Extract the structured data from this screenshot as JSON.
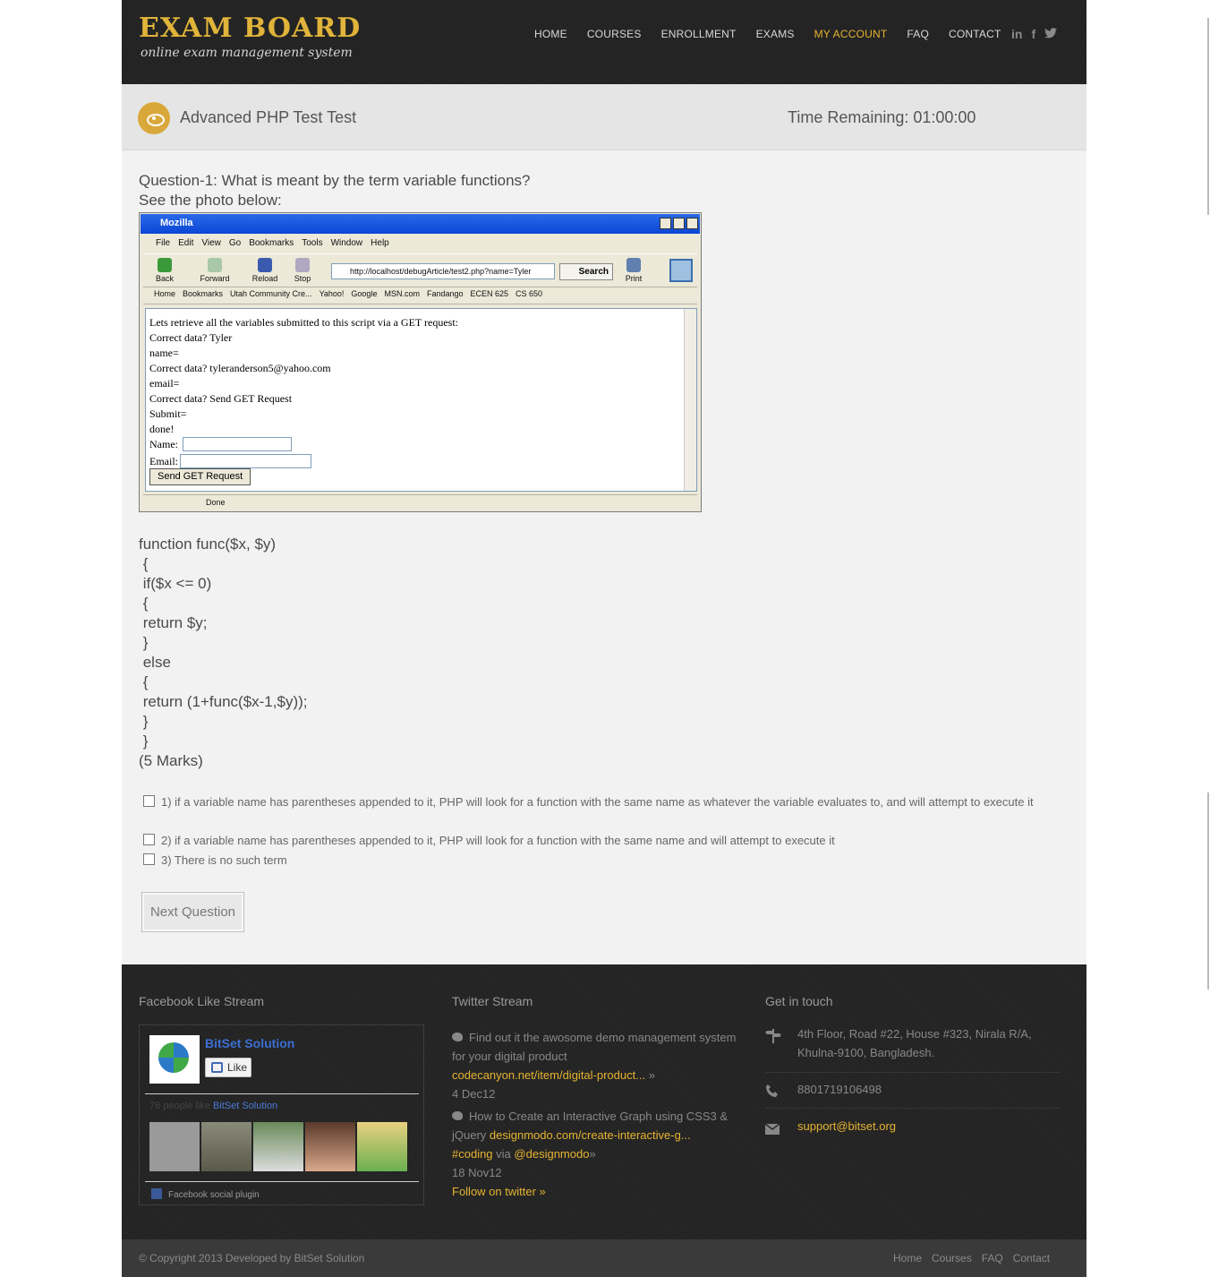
{
  "header": {
    "logo_title": "EXAM BOARD",
    "logo_subtitle": "online exam management system",
    "nav": [
      "HOME",
      "COURSES",
      "ENROLLMENT",
      "EXAMS",
      "MY ACCOUNT",
      "FAQ",
      "CONTACT"
    ],
    "active_nav": "MY ACCOUNT",
    "social": [
      "in",
      "f",
      "t"
    ],
    "accent_color": "#e6b432"
  },
  "test": {
    "title": "Advanced PHP Test Test",
    "time_remaining": "Time Remaining: 01:00:00"
  },
  "question": {
    "title": "Question-1: What is meant by the term variable functions?",
    "subtitle": "See the photo below:",
    "code_lines": [
      "function func($x, $y)",
      " {",
      " if($x <= 0)",
      " {",
      " return $y;",
      " }",
      " else",
      " {",
      " return (1+func($x-1,$y));",
      " }",
      " }",
      "(5 Marks)"
    ],
    "options": [
      "1) if a variable name has parentheses appended to it, PHP will look for a function with the same name as whatever the variable evaluates to, and will attempt to execute it",
      "2) if a variable name has parentheses appended to it, PHP will look for a function with the same name and will attempt to execute it",
      "3) There is no such term"
    ],
    "next_button": "Next Question"
  },
  "screenshot": {
    "window_title": "Mozilla",
    "menu": [
      "File",
      "Edit",
      "View",
      "Go",
      "Bookmarks",
      "Tools",
      "Window",
      "Help"
    ],
    "tools": [
      "Back",
      "Forward",
      "Reload",
      "Stop",
      "Print"
    ],
    "url": "http://localhost/debugArticle/test2.php?name=Tyler",
    "search_label": "Search",
    "bookmarks": [
      "Home",
      "Bookmarks",
      "Utah Community Cre...",
      "Yahoo!",
      "Google",
      "MSN.com",
      "Fandango",
      "ECEN 625",
      "CS 650"
    ],
    "content_lines": [
      "Lets retrieve all the variables submitted to this script via a GET request:",
      "Correct data? Tyler",
      "name=",
      "Correct data? tyleranderson5@yahoo.com",
      "email=",
      "Correct data? Send GET Request",
      "Submit=",
      "done!"
    ],
    "name_label": "Name:",
    "email_label": "Email:",
    "send_button": "Send GET Request",
    "status": "Done"
  },
  "footer": {
    "facebook": {
      "heading": "Facebook Like Stream",
      "page_name": "BitSet Solution",
      "like_label": "Like",
      "count_prefix": "76 people like",
      "count_page": "BitSet Solution",
      "plugin_label": "Facebook social plugin"
    },
    "twitter": {
      "heading": "Twitter Stream",
      "tweet1_text": "Find out it the awosome demo management system for your digital product",
      "tweet1_link": "codecanyon.net/item/digital-product...",
      "tweet1_more": "»",
      "tweet1_date": "4 Dec12",
      "tweet2_text": "How to Create an Interactive Graph using CSS3 & jQuery",
      "tweet2_link": "designmodo.com/create-interactive-g...",
      "tweet2_tag": "#coding",
      "tweet2_via": "via",
      "tweet2_user": "@designmodo",
      "tweet2_more": "»",
      "tweet2_date": "18 Nov12",
      "follow": "Follow on twitter »"
    },
    "contact": {
      "heading": "Get in touch",
      "address": "4th Floor, Road #22, House #323, Nirala R/A, Khulna-9100, Bangladesh.",
      "phone": "8801719106498",
      "email": "support@bitset.org"
    },
    "copyright": "© Copyright 2013  Developed by BitSet Solution",
    "links": [
      "Home",
      "Courses",
      "FAQ",
      "Contact"
    ]
  }
}
